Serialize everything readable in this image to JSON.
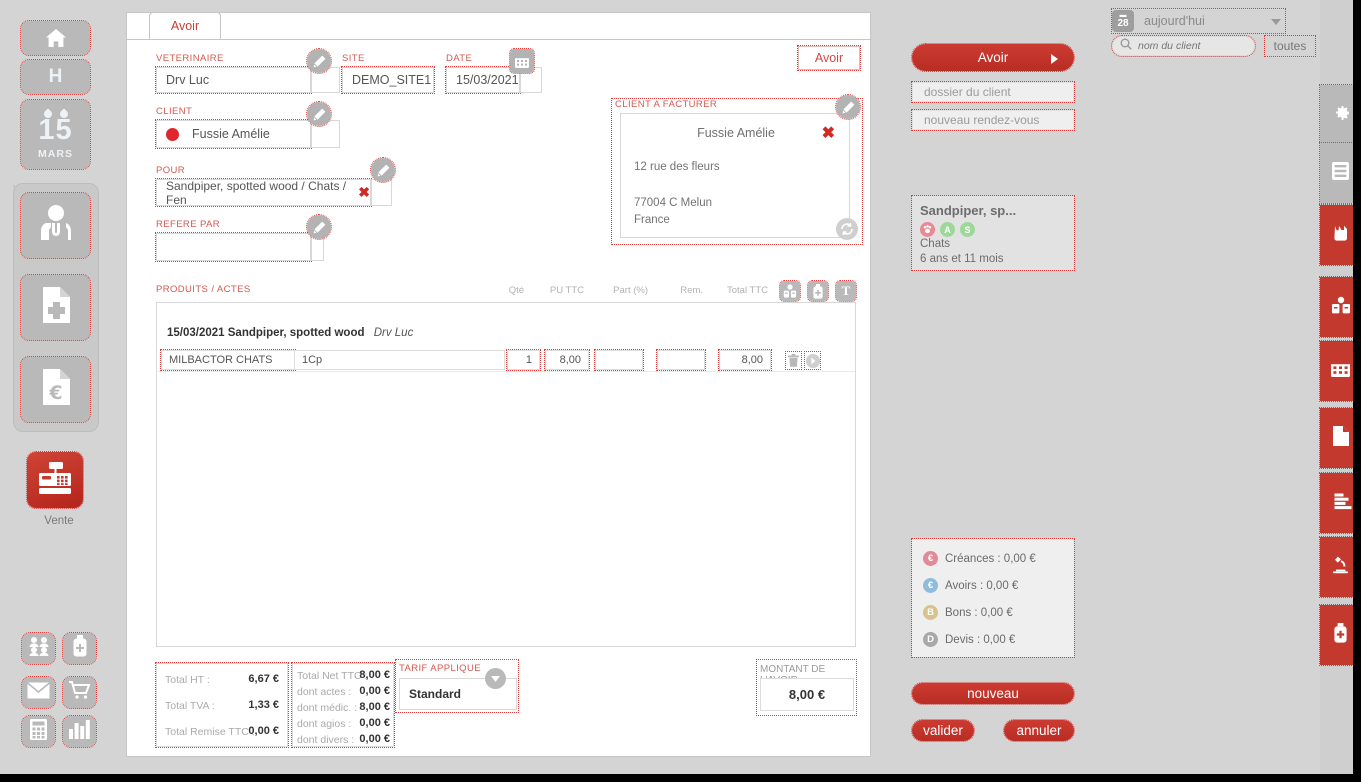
{
  "left_rail": {
    "items": [
      {
        "name": "home",
        "icon": "home-icon",
        "label": ""
      },
      {
        "name": "h-button",
        "icon": "letter-h-icon",
        "label": "H"
      },
      {
        "name": "calendar-day",
        "icon": "calendar-icon",
        "day": "15",
        "month": "MARS"
      },
      {
        "name": "veterinarian",
        "icon": "doctor-icon",
        "label": ""
      },
      {
        "name": "medical-file",
        "icon": "file-plus-icon",
        "label": ""
      },
      {
        "name": "invoice-file",
        "icon": "file-euro-icon",
        "label": ""
      },
      {
        "name": "vente",
        "icon": "cash-register-icon",
        "label": "Vente"
      }
    ],
    "bottom_items": [
      {
        "name": "clients",
        "icon": "people-icon"
      },
      {
        "name": "stock",
        "icon": "bottle-plus-icon"
      },
      {
        "name": "mail",
        "icon": "envelope-icon"
      },
      {
        "name": "cart",
        "icon": "shopping-cart-icon"
      },
      {
        "name": "calculator",
        "icon": "calculator-icon"
      },
      {
        "name": "stats",
        "icon": "bar-chart-icon"
      }
    ]
  },
  "form": {
    "tab_label": "Avoir",
    "header_button": "Avoir",
    "veterinaire": {
      "label": "VETERINAIRE",
      "value": "Drv Luc"
    },
    "site": {
      "label": "SITE",
      "value": "DEMO_SITE1"
    },
    "date": {
      "label": "DATE",
      "value": "15/03/2021"
    },
    "client": {
      "label": "CLIENT",
      "value": "Fussie Amélie"
    },
    "pour": {
      "label": "POUR",
      "value": "Sandpiper, spotted wood / Chats / Fen"
    },
    "refere_par": {
      "label": "REFERE PAR",
      "value": ""
    },
    "client_a_facturer": {
      "label": "CLIENT A FACTURER",
      "name": "Fussie Amélie",
      "address_line1": "12 rue des fleurs",
      "address_line2": "77004 C Melun",
      "country": "France"
    }
  },
  "products_table": {
    "title": "PRODUITS / ACTES",
    "columns": [
      "Qté",
      "PU TTC",
      "Part (%)",
      "Rem.",
      "Total TTC"
    ],
    "header_icons": [
      "pharmacy-icon",
      "bottle-icon",
      "text-t-icon"
    ],
    "group_header": {
      "date": "15/03/2021",
      "patient": "Sandpiper, spotted wood",
      "vet": "Drv Luc"
    },
    "rows": [
      {
        "designation": "MILBACTOR CHATS",
        "unit": "1Cp",
        "qte": "1",
        "pu_ttc": "8,00",
        "part": "",
        "rem": "",
        "total_ttc": "8,00",
        "row_icons": [
          "trash-icon",
          "expand-icon"
        ]
      }
    ]
  },
  "totals": {
    "left": [
      {
        "label": "Total HT :",
        "value": "6,67 €"
      },
      {
        "label": "Total TVA :",
        "value": "1,33 €"
      },
      {
        "label": "Total Remise TTC :",
        "value": "0,00 €"
      }
    ],
    "right": [
      {
        "label": "Total Net TTC :",
        "value": "8,00 €"
      },
      {
        "label": "dont actes :",
        "value": "0,00 €"
      },
      {
        "label": "dont médic. :",
        "value": "8,00 €"
      },
      {
        "label": "dont agios :",
        "value": "0,00 €"
      },
      {
        "label": "dont divers :",
        "value": "0,00 €"
      }
    ],
    "tarif": {
      "label": "TARIF APPLIQUE",
      "value": "Standard"
    },
    "montant": {
      "label": "MONTANT DE L'AVOIR",
      "value": "8,00 €"
    }
  },
  "right_panel": {
    "primary_button": "Avoir",
    "links": [
      "dossier du client",
      "nouveau rendez-vous"
    ],
    "pet": {
      "name": "Sandpiper, sp...",
      "species": "Chats",
      "age": "6 ans et 11 mois",
      "badges": [
        {
          "letter": "",
          "icon": "paw-icon",
          "color": "#e88a94"
        },
        {
          "letter": "A",
          "icon": "letter-a-icon",
          "color": "#9ed79a"
        },
        {
          "letter": "S",
          "icon": "letter-s-icon",
          "color": "#9ed79a"
        }
      ]
    },
    "finance": [
      {
        "badge": "€",
        "label": "Créances : 0,00 €",
        "color": "#e08b97"
      },
      {
        "badge": "€",
        "label": "Avoirs : 0,00 €",
        "color": "#8fbcdb"
      },
      {
        "badge": "B",
        "label": "Bons : 0,00 €",
        "color": "#d8c28e"
      },
      {
        "badge": "D",
        "label": "Devis : 0,00 €",
        "color": "#a8a8a8"
      }
    ],
    "actions": {
      "new": "nouveau",
      "validate": "valider",
      "cancel": "annuler"
    }
  },
  "topbar": {
    "date_chip": "28",
    "date_label": "aujourd'hui",
    "search_placeholder": "nom du client",
    "filter_button": "toutes"
  },
  "right_rail": {
    "items": [
      {
        "name": "settings",
        "icon": "gear-icon",
        "style": "grey"
      },
      {
        "name": "list",
        "icon": "list-icon",
        "style": "grey"
      },
      {
        "name": "animal",
        "icon": "cat-icon",
        "style": "red"
      },
      {
        "name": "client",
        "icon": "person-card-icon",
        "style": "red"
      },
      {
        "name": "agenda",
        "icon": "calendar-grid-icon",
        "style": "red"
      },
      {
        "name": "document",
        "icon": "page-icon",
        "style": "red"
      },
      {
        "name": "report",
        "icon": "chart-icon",
        "style": "red"
      },
      {
        "name": "lab",
        "icon": "microscope-icon",
        "style": "red"
      },
      {
        "name": "pharmacy",
        "icon": "medicine-bottle-icon",
        "style": "red"
      }
    ]
  },
  "colors": {
    "brand_red": "#c4392e",
    "label_red": "#d15a52",
    "panel_grey": "#d4d4d4"
  }
}
